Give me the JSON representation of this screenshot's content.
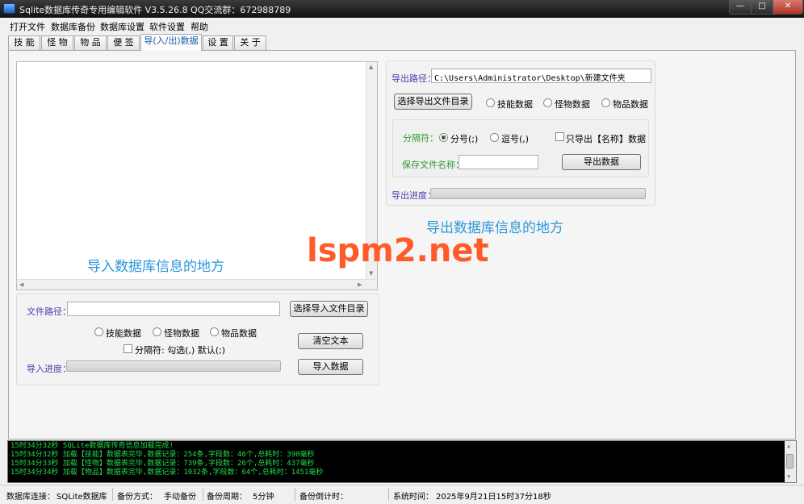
{
  "window": {
    "title": "Sqlite数据库传奇专用编辑软件 V3.5.26.8",
    "qq": "QQ交流群：672988789",
    "min_symbol": "—",
    "max_symbol": "□",
    "close_symbol": "✕"
  },
  "menu": [
    "打开文件",
    "数据库备份",
    "数据库设置",
    "软件设置",
    "帮助"
  ],
  "tabs": [
    "技 能",
    "怪 物",
    "物 品",
    "便 签",
    "导(入/出)数据",
    "设 置",
    "关 于"
  ],
  "active_tab_index": 4,
  "import": {
    "hint": "导入数据库信息的地方",
    "path_label": "文件路径：",
    "path_value": "",
    "select_button": "选择导入文件目录",
    "radio_skill": "技能数据",
    "radio_monster": "怪物数据",
    "radio_item": "物品数据",
    "clear_button": "清空文本",
    "separator_label": "分隔符: 勾选(,) 默认(;)",
    "progress_label": "导入进度：",
    "import_button": "导入数据",
    "progress": 0
  },
  "export": {
    "path_label": "导出路径：",
    "path_value": "C:\\Users\\Administrator\\Desktop\\新建文件夹",
    "select_button": "选择导出文件目录",
    "radio_skill": "技能数据",
    "radio_monster": "怪物数据",
    "radio_item": "物品数据",
    "separator_label": "分隔符：",
    "sep_semicolon": "分号(;)",
    "sep_comma": "逗号(,)",
    "only_name_label": "只导出【名称】数据",
    "filename_label": "保存文件名称：",
    "filename_value": "",
    "export_button": "导出数据",
    "progress_label": "导出进度：",
    "progress": 0,
    "hint": "导出数据库信息的地方"
  },
  "watermark": "lspm2.net",
  "log": [
    "15时34分32秒  SQLite数据库传奇信息加载完成!",
    "15时34分32秒  加载【技能】数据表完毕,数据记录：254条,字段数：46个,总耗时：390毫秒",
    "15时34分33秒  加载【怪物】数据表完毕,数据记录：739条,字段数：26个,总耗时：437毫秒",
    "15时34分34秒  加载【物品】数据表完毕,数据记录：1032条,字段数：64个,总耗时：1451毫秒"
  ],
  "status": {
    "db_conn_label": "数据库连接：",
    "db_conn_value": "SQLite数据库",
    "backup_mode_label": "备份方式：",
    "backup_mode_value": "手动备份",
    "backup_period_label": "备份周期：",
    "backup_period_value": "5分钟",
    "backup_countdown_label": "备份倒计时：",
    "system_time_label": "系统时间：",
    "system_time_value": "2025年9月21日15时37分18秒"
  },
  "colors": {
    "hint": "#2c97d8",
    "watermark": "#ff5a2a",
    "log_text": "#1ee04b"
  }
}
